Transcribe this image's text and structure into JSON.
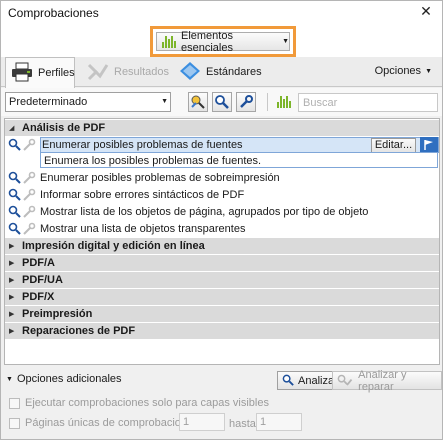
{
  "window": {
    "title": "Comprobaciones",
    "close_glyph": "✕"
  },
  "essentials": {
    "label": "Elementos esenciales",
    "highlight_color": "#f19a3a",
    "accent_color": "#7cb52a"
  },
  "tabs": [
    {
      "label": "Perfiles",
      "icon": "printer-icon",
      "state": "active"
    },
    {
      "label": "Resultados",
      "icon": "results-icon",
      "state": "disabled"
    },
    {
      "label": "Estándares",
      "icon": "standards-icon",
      "state": "normal"
    }
  ],
  "options_label": "Opciones",
  "toolbar": {
    "profile_value": "Predeterminado",
    "search_placeholder": "Buscar",
    "icons": [
      "fix-profile-icon",
      "check-magnifier-icon",
      "wrench-icon",
      "essentials-bars-icon"
    ]
  },
  "tree": {
    "groups": [
      {
        "label": "Análisis de PDF",
        "expanded": true
      },
      {
        "label": "Impresión digital y edición en línea",
        "expanded": false
      },
      {
        "label": "PDF/A",
        "expanded": false
      },
      {
        "label": "PDF/UA",
        "expanded": false
      },
      {
        "label": "PDF/X",
        "expanded": false
      },
      {
        "label": "Preimpresión",
        "expanded": false
      },
      {
        "label": "Reparaciones de PDF",
        "expanded": false
      }
    ],
    "items": [
      {
        "label": "Enumerar posibles problemas de fuentes",
        "selected": true
      },
      {
        "label": "Enumerar posibles problemas de sobreimpresión",
        "selected": false
      },
      {
        "label": "Informar sobre errores sintácticos de PDF",
        "selected": false
      },
      {
        "label": "Mostrar lista de los objetos de página, agrupados por tipo de objeto",
        "selected": false
      },
      {
        "label": "Mostrar una lista de objetos transparentes",
        "selected": false
      }
    ],
    "selected_description": "Enumera los posibles problemas de fuentes.",
    "edit_label": "Editar...",
    "selection_color": "#2f6fc0"
  },
  "bottom": {
    "more_options_label": "Opciones adicionales",
    "analyze_label": "Analizar",
    "analyze_fix_label": "Analizar y reparar",
    "visible_layers_label": "Ejecutar comprobaciones solo para capas visibles",
    "single_pages_label": "Páginas únicas de comprobaciones",
    "from_value": "1",
    "to_label": "hasta",
    "to_value": "1"
  }
}
